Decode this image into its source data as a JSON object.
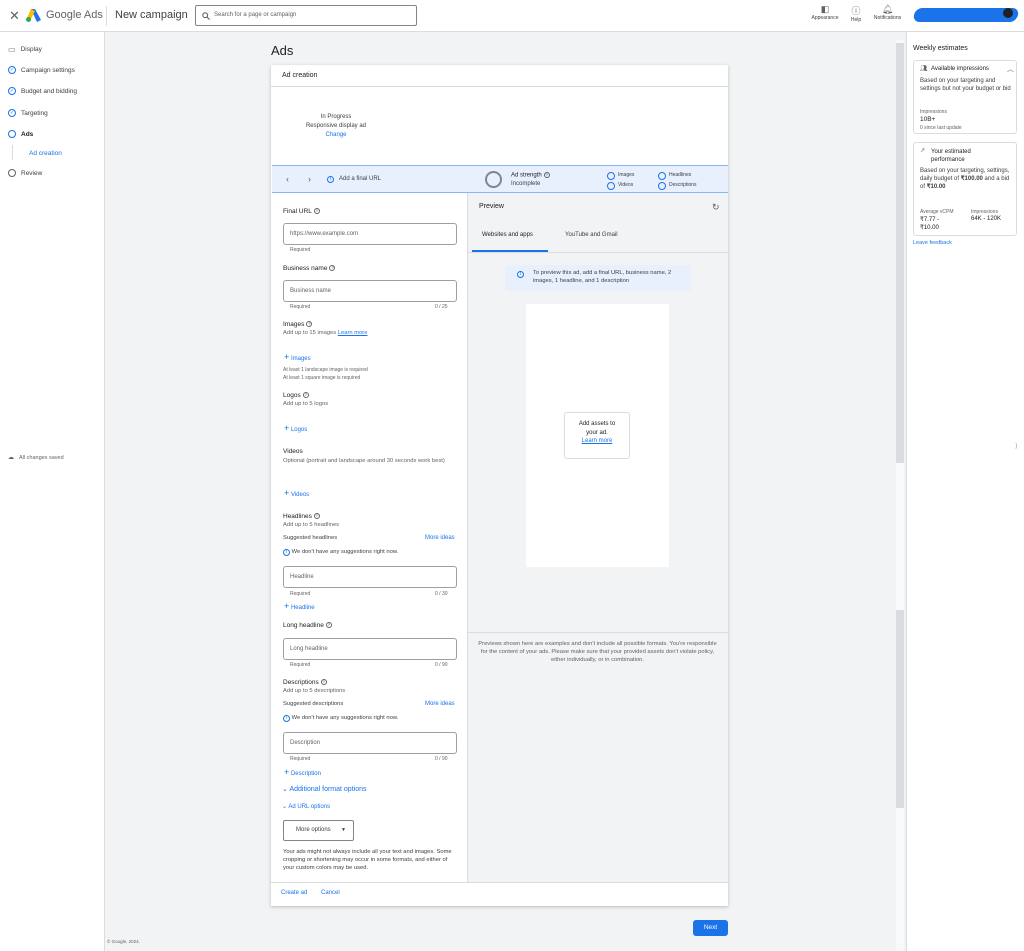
{
  "topbar": {
    "product": "Google Ads",
    "page_title": "New campaign",
    "search_placeholder": "Search for a page or campaign",
    "appearance": "Appearance",
    "help": "Help",
    "notifications": "Notifications"
  },
  "nav": {
    "items": [
      {
        "label": "Display"
      },
      {
        "label": "Campaign settings"
      },
      {
        "label": "Budget and bidding"
      },
      {
        "label": "Targeting"
      },
      {
        "label": "Ads"
      },
      {
        "label": "Ad creation"
      },
      {
        "label": "Review"
      }
    ],
    "saved": "All changes saved",
    "footer": "© Google, 2024."
  },
  "main": {
    "heading": "Ads",
    "card_title": "Ad creation",
    "status": "In Progress",
    "ad_type": "Responsive display ad",
    "change": "Change",
    "toolbar": {
      "hint": "Add a final URL",
      "strength_label": "Ad strength",
      "strength_value": "Incomplete",
      "chk_images": "Images",
      "chk_headlines": "Headlines",
      "chk_videos": "Videos",
      "chk_descriptions": "Descriptions"
    },
    "form": {
      "final_url_label": "Final URL",
      "final_url_placeholder": "https://www.example.com",
      "required": "Required",
      "business_label": "Business name",
      "business_placeholder": "Business name",
      "business_count": "0 / 25",
      "images_label": "Images",
      "images_sub": "Add up to 15 images",
      "learn_more": "Learn more",
      "images_btn": "Images",
      "images_note1": "At least 1 landscape image is required",
      "images_note2": "At least 1 square image is required",
      "logos_label": "Logos",
      "logos_sub": "Add up to 5 logos",
      "logos_btn": "Logos",
      "videos_label": "Videos",
      "videos_sub": "Optional (portrait and landscape around 30 seconds work best)",
      "videos_btn": "Videos",
      "headlines_label": "Headlines",
      "headlines_sub": "Add up to 5 headlines",
      "suggested_headlines": "Suggested headlines",
      "more_ideas": "More ideas",
      "no_suggestions": "We don't have any suggestions right now.",
      "headline_placeholder": "Headline",
      "headline_count": "0 / 30",
      "headline_btn": "Headline",
      "long_headline_label": "Long headline",
      "long_headline_placeholder": "Long headline",
      "long_headline_count": "0 / 90",
      "descriptions_label": "Descriptions",
      "descriptions_sub": "Add up to 5 descriptions",
      "suggested_descriptions": "Suggested descriptions",
      "description_placeholder": "Description",
      "description_count": "0 / 90",
      "description_btn": "Description",
      "additional_format": "Additional format options",
      "ad_url_options": "Ad URL options",
      "more_options": "More options",
      "disclaimer": "Your ads might not always include all your text and images. Some cropping or shortening may occur in some formats, and either of your custom colors may be used."
    },
    "preview": {
      "title": "Preview",
      "tab1": "Websites and apps",
      "tab2": "YouTube and Gmail",
      "info": "To preview this ad, add a final URL, business name, 2 images, 1 headline, and 1 description",
      "add_assets": "Add assets to your ad.",
      "learn_more": "Learn more",
      "footer": "Previews shown here are examples and don't include all possible formats. You're responsible for the content of your ads. Please make sure that your provided assets don't violate policy, either individually, or in combination."
    },
    "create_ad": "Create ad",
    "cancel": "Cancel",
    "next": "Next"
  },
  "right": {
    "title": "Weekly estimates",
    "impressions_title": "Available impressions",
    "impressions_desc": "Based on your targeting and settings but not your budget or bid",
    "impressions_label": "Impressions",
    "impressions_value": "10B+",
    "impressions_update": "0 since last update",
    "perf_title": "Your estimated performance",
    "perf_desc_1": "Based on your targeting, settings, daily budget of",
    "perf_budget": "₹100.00",
    "perf_desc_2": "and a bid of",
    "perf_bid": "₹10.00",
    "avg_label": "Average vCPM",
    "avg_value": "₹7.77 - ₹10.00",
    "imp_label": "Impressions",
    "imp_value": "64K - 120K",
    "feedback": "Leave feedback"
  }
}
